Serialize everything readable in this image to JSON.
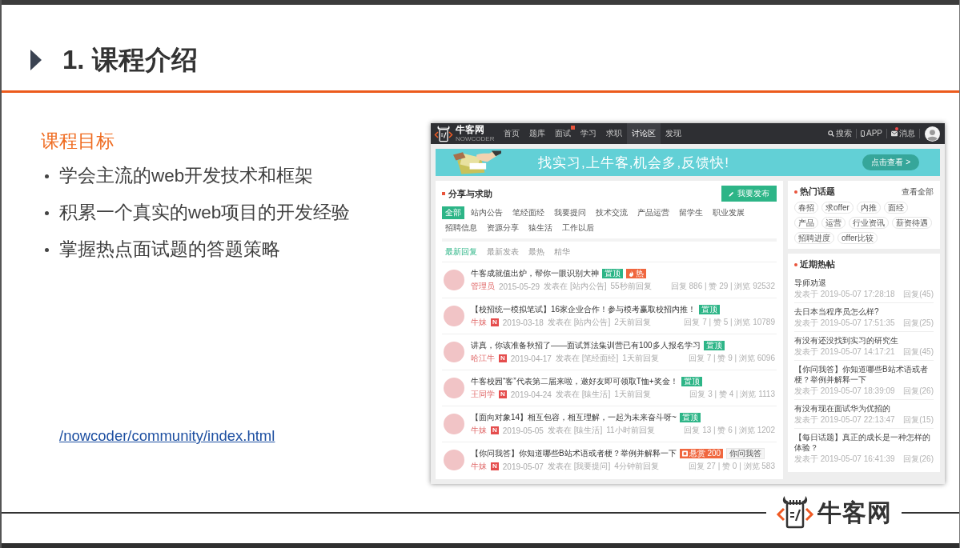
{
  "slide": {
    "title": "1. 课程介绍",
    "section_heading": "课程目标",
    "bullets": [
      "学会主流的web开发技术和框架",
      "积累一个真实的web项目的开发经验",
      "掌握热点面试题的答题策略"
    ],
    "link": "/nowcoder/community/index.html"
  },
  "screenshot": {
    "navbar": {
      "logo_text": "牛客网",
      "logo_subtext": "NOWCODER",
      "items": [
        {
          "label": "首页",
          "selected": false,
          "badge": false
        },
        {
          "label": "题库",
          "selected": false,
          "badge": false
        },
        {
          "label": "面试",
          "selected": false,
          "badge": true
        },
        {
          "label": "学习",
          "selected": false,
          "badge": false
        },
        {
          "label": "求职",
          "selected": false,
          "badge": false
        },
        {
          "label": "讨论区",
          "selected": true,
          "badge": false
        },
        {
          "label": "发现",
          "selected": false,
          "badge": false
        }
      ],
      "actions": [
        {
          "kind": "search",
          "label": "搜索",
          "badge": false
        },
        {
          "kind": "app",
          "label": "APP",
          "badge": false
        },
        {
          "kind": "message",
          "label": "消息",
          "badge": true
        }
      ]
    },
    "banner": {
      "text": "找实习,上牛客,机会多,反馈快!",
      "button": "点击查看 >"
    },
    "feed": {
      "title": "分享与求助",
      "post_button": "我要发布",
      "categories": [
        {
          "label": "全部",
          "selected": true
        },
        {
          "label": "站内公告",
          "selected": false
        },
        {
          "label": "笔经面经",
          "selected": false
        },
        {
          "label": "我要提问",
          "selected": false
        },
        {
          "label": "技术交流",
          "selected": false
        },
        {
          "label": "产品运营",
          "selected": false
        },
        {
          "label": "留学生",
          "selected": false
        },
        {
          "label": "职业发展",
          "selected": false
        },
        {
          "label": "招聘信息",
          "selected": false
        },
        {
          "label": "资源分享",
          "selected": false
        },
        {
          "label": "猿生活",
          "selected": false
        },
        {
          "label": "工作以后",
          "selected": false
        }
      ],
      "sort_tabs": [
        {
          "label": "最新回复",
          "selected": true
        },
        {
          "label": "最新发表",
          "selected": false
        },
        {
          "label": "最热",
          "selected": false
        },
        {
          "label": "精华",
          "selected": false
        }
      ],
      "posts": [
        {
          "title": "牛客成就值出炉，帮你一眼识别大神",
          "tags": [
            {
              "kind": "top",
              "label": "置顶"
            },
            {
              "kind": "hot",
              "label": "热"
            }
          ],
          "author": "管理员",
          "date": "2015-05-29",
          "board": "发表在 [站内公告]",
          "last_reply": "55秒前回复",
          "stats": "回复 886 | 赞 29 | 浏览 92532"
        },
        {
          "title": "【校招统一模拟笔试】16家企业合作！参与模考赢取校招内推！",
          "tags": [
            {
              "kind": "top",
              "label": "置顶"
            }
          ],
          "author": "牛妹",
          "author_badge": "N",
          "date": "2019-03-18",
          "board": "发表在 [站内公告]",
          "last_reply": "2天前回复",
          "stats": "回复 7 | 赞 5 | 浏览 10789"
        },
        {
          "title": "讲真，你该准备秋招了——面试算法集训营已有100多人报名学习",
          "tags": [
            {
              "kind": "top",
              "label": "置顶"
            }
          ],
          "author": "哈江牛",
          "author_badge": "N",
          "date": "2019-04-17",
          "board": "发表在 [笔经面经]",
          "last_reply": "1天前回复",
          "stats": "回复 7 | 赞 9 | 浏览 6096"
        },
        {
          "title": "牛客校园“客”代表第二届来啦，邀好友即可领取T恤+奖金！",
          "tags": [
            {
              "kind": "top",
              "label": "置顶"
            }
          ],
          "author": "王同学",
          "author_badge": "N",
          "date": "2019-04-24",
          "board": "发表在 [猿生活]",
          "last_reply": "1天前回复",
          "stats": "回复 3 | 赞 4 | 浏览 1113"
        },
        {
          "title": "【面向对象14】相互包容，相互理解，一起为未来奋斗呀~",
          "tags": [
            {
              "kind": "top",
              "label": "置顶"
            }
          ],
          "author": "牛妹",
          "author_badge": "N",
          "date": "2019-05-05",
          "board": "发表在 [猿生活]",
          "last_reply": "11小时前回复",
          "stats": "回复 13 | 赞 6 | 浏览 1202"
        },
        {
          "title": "【你问我答】你知道哪些B站术语或者梗？举例并解释一下",
          "tags": [
            {
              "kind": "reward",
              "label": "悬赏 200"
            },
            {
              "kind": "topic",
              "label": "你问我答"
            }
          ],
          "author": "牛妹",
          "author_badge": "N",
          "date": "2019-05-07",
          "board": "发表在 [我要提问]",
          "last_reply": "4分钟前回复",
          "stats": "回复 27 | 赞 0 | 浏览 583"
        }
      ]
    },
    "hot_topics": {
      "title": "热门话题",
      "view_all": "查看全部",
      "tags": [
        "春招",
        "求offer",
        "内推",
        "面经",
        "产品",
        "运营",
        "行业资讯",
        "薪资待遇",
        "招聘进度",
        "offer比较"
      ]
    },
    "recent_posts": {
      "title": "近期热帖",
      "items": [
        {
          "title": "导师劝退",
          "posted": "发表于 2019-05-07 17:28:18",
          "replies": "回复(45)"
        },
        {
          "title": "去日本当程序员怎么样?",
          "posted": "发表于 2019-05-07 17:51:35",
          "replies": "回复(25)"
        },
        {
          "title": "有没有还没找到实习的研究生",
          "posted": "发表于 2019-05-07 14:17:21",
          "replies": "回复(45)"
        },
        {
          "title": "【你问我答】你知道哪些B站术语或者梗？举例并解释一下",
          "posted": "发表于 2019-05-07 18:39:09",
          "replies": "回复(26)"
        },
        {
          "title": "有没有现在面试华为优招的",
          "posted": "发表于 2019-05-07 22:13:47",
          "replies": "回复(15)"
        },
        {
          "title": "【每日话题】真正的成长是一种怎样的体验？",
          "posted": "发表于 2019-05-07 16:41:39",
          "replies": "回复(26)"
        }
      ]
    }
  },
  "footer": {
    "logo_text": "牛客网"
  }
}
